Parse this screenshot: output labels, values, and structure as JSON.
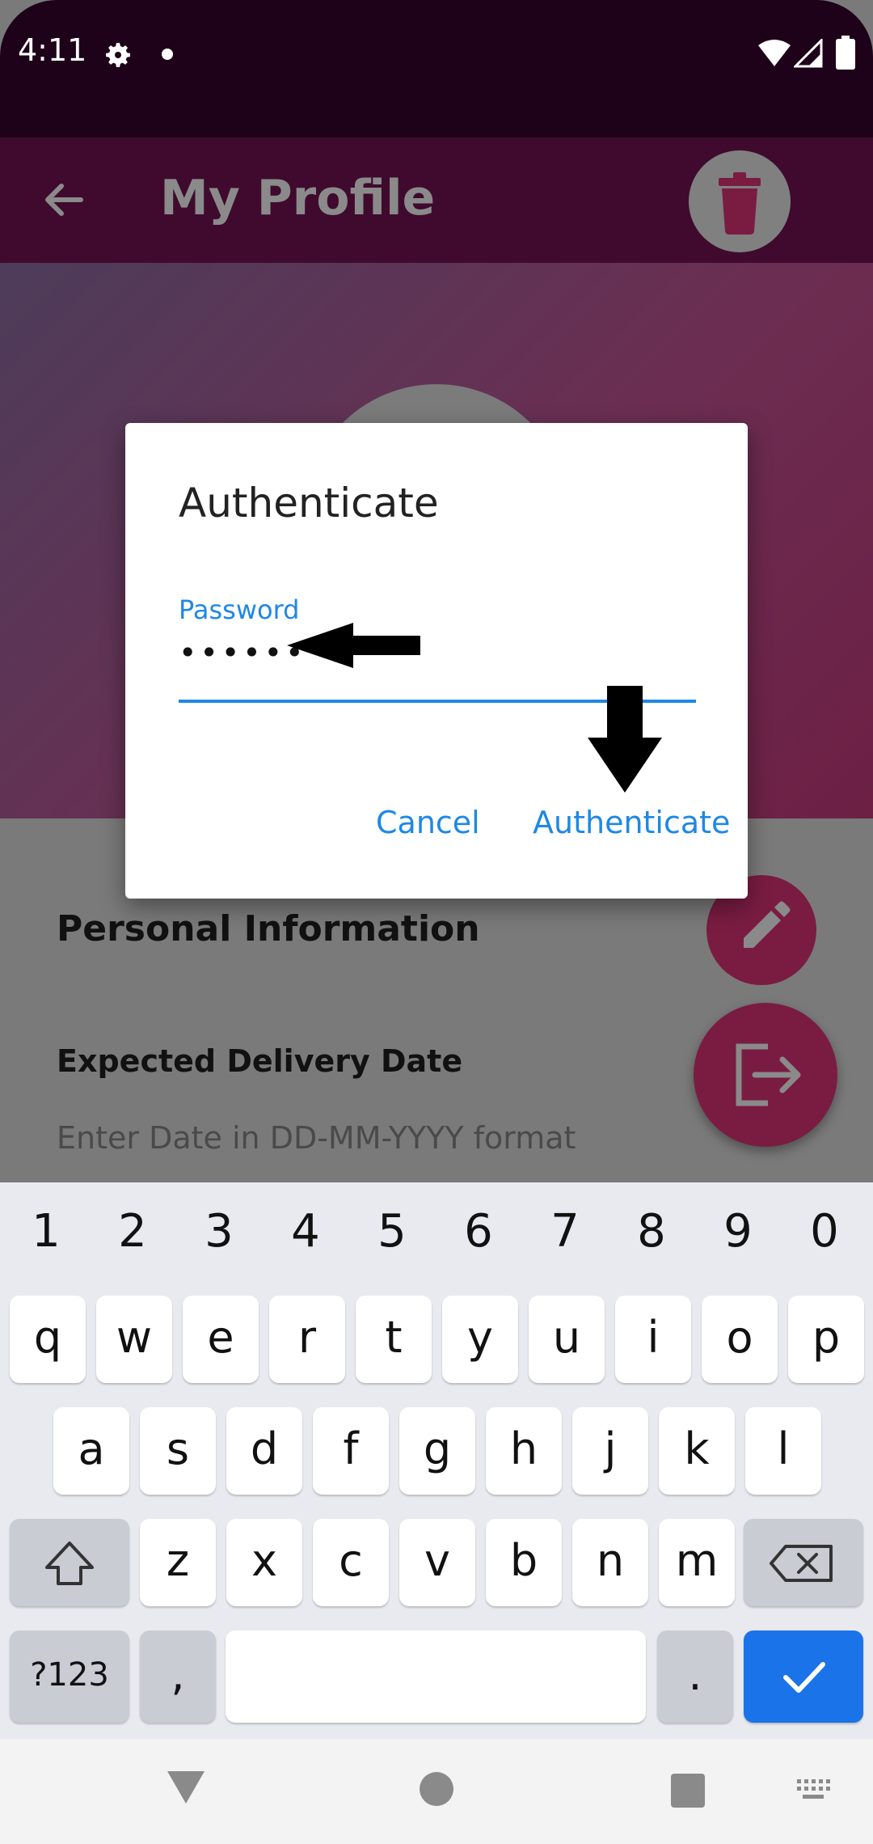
{
  "status_bar": {
    "time": "4:11",
    "icons": [
      "settings-icon",
      "dot-icon",
      "wifi-icon",
      "signal-icon",
      "battery-icon"
    ]
  },
  "app_bar": {
    "title": "My Profile",
    "back_icon": "back-arrow-icon",
    "action_icon": "trash-icon"
  },
  "profile": {
    "section_title": "Personal Information",
    "field_label": "Expected Delivery Date",
    "field_placeholder": "Enter Date in DD-MM-YYYY format"
  },
  "dialog": {
    "title": "Authenticate",
    "password_label": "Password",
    "password_value": "••••••",
    "cancel_label": "Cancel",
    "confirm_label": "Authenticate"
  },
  "keyboard": {
    "numbers": [
      "1",
      "2",
      "3",
      "4",
      "5",
      "6",
      "7",
      "8",
      "9",
      "0"
    ],
    "row1": [
      "q",
      "w",
      "e",
      "r",
      "t",
      "y",
      "u",
      "i",
      "o",
      "p"
    ],
    "row2": [
      "a",
      "s",
      "d",
      "f",
      "g",
      "h",
      "j",
      "k",
      "l"
    ],
    "row3": [
      "z",
      "x",
      "c",
      "v",
      "b",
      "n",
      "m"
    ],
    "symbols_label": "?123",
    "comma_label": ",",
    "period_label": "."
  },
  "colors": {
    "accent": "#1e88e5",
    "fab": "#7a1c42",
    "enter_key": "#1a73e8"
  }
}
